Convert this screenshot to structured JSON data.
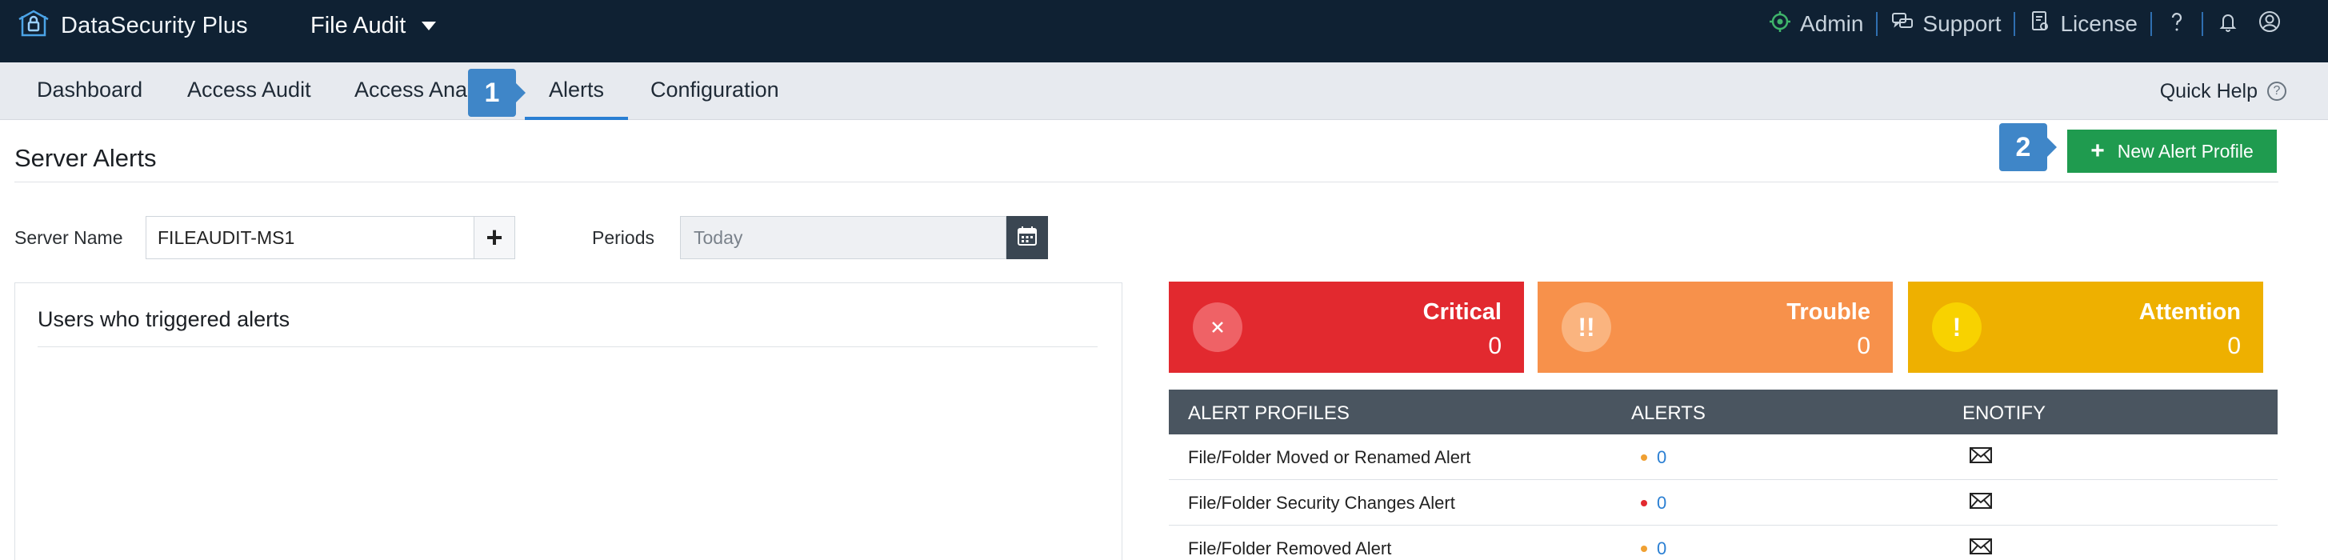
{
  "header": {
    "brand": "DataSecurity Plus",
    "module": "File Audit",
    "actions": {
      "admin": "Admin",
      "support": "Support",
      "license": "License"
    },
    "icons": [
      "brand-logo-icon",
      "admin-icon",
      "support-icon",
      "license-icon",
      "help-icon",
      "bell-icon",
      "user-icon"
    ]
  },
  "nav": {
    "tabs": [
      {
        "label": "Dashboard"
      },
      {
        "label": "Access Audit"
      },
      {
        "label": "Access Analysis"
      },
      {
        "label": "Alerts"
      },
      {
        "label": "Configuration"
      }
    ],
    "active_tab": "Alerts",
    "quick_help": "Quick Help"
  },
  "callouts": {
    "one": "1",
    "two": "2"
  },
  "page": {
    "title": "Server Alerts",
    "new_alert_button": "New Alert Profile"
  },
  "filters": {
    "server_label": "Server Name",
    "server_value": "FILEAUDIT-MS1",
    "periods_label": "Periods",
    "periods_value": "Today"
  },
  "users_panel": {
    "title": "Users who triggered alerts"
  },
  "severity": {
    "critical": {
      "label": "Critical",
      "count": "0",
      "color": "#e2292f"
    },
    "trouble": {
      "label": "Trouble",
      "count": "0",
      "color": "#f7914b"
    },
    "attention": {
      "label": "Attention",
      "count": "0",
      "color": "#eeb000"
    }
  },
  "alert_table": {
    "headers": {
      "profiles": "ALERT PROFILES",
      "alerts": "ALERTS",
      "enotify": "ENOTIFY"
    },
    "rows": [
      {
        "name": "File/Folder Moved or Renamed Alert",
        "count": "0",
        "severity_color": "#f0a032"
      },
      {
        "name": "File/Folder Security Changes Alert",
        "count": "0",
        "severity_color": "#e2292f"
      },
      {
        "name": "File/Folder Removed Alert",
        "count": "0",
        "severity_color": "#f0a032"
      }
    ]
  },
  "colors": {
    "topbar": "#0f2133",
    "accent": "#2a7fd3",
    "new_alert_button": "#1f9b4f",
    "table_header": "#4a5560"
  }
}
